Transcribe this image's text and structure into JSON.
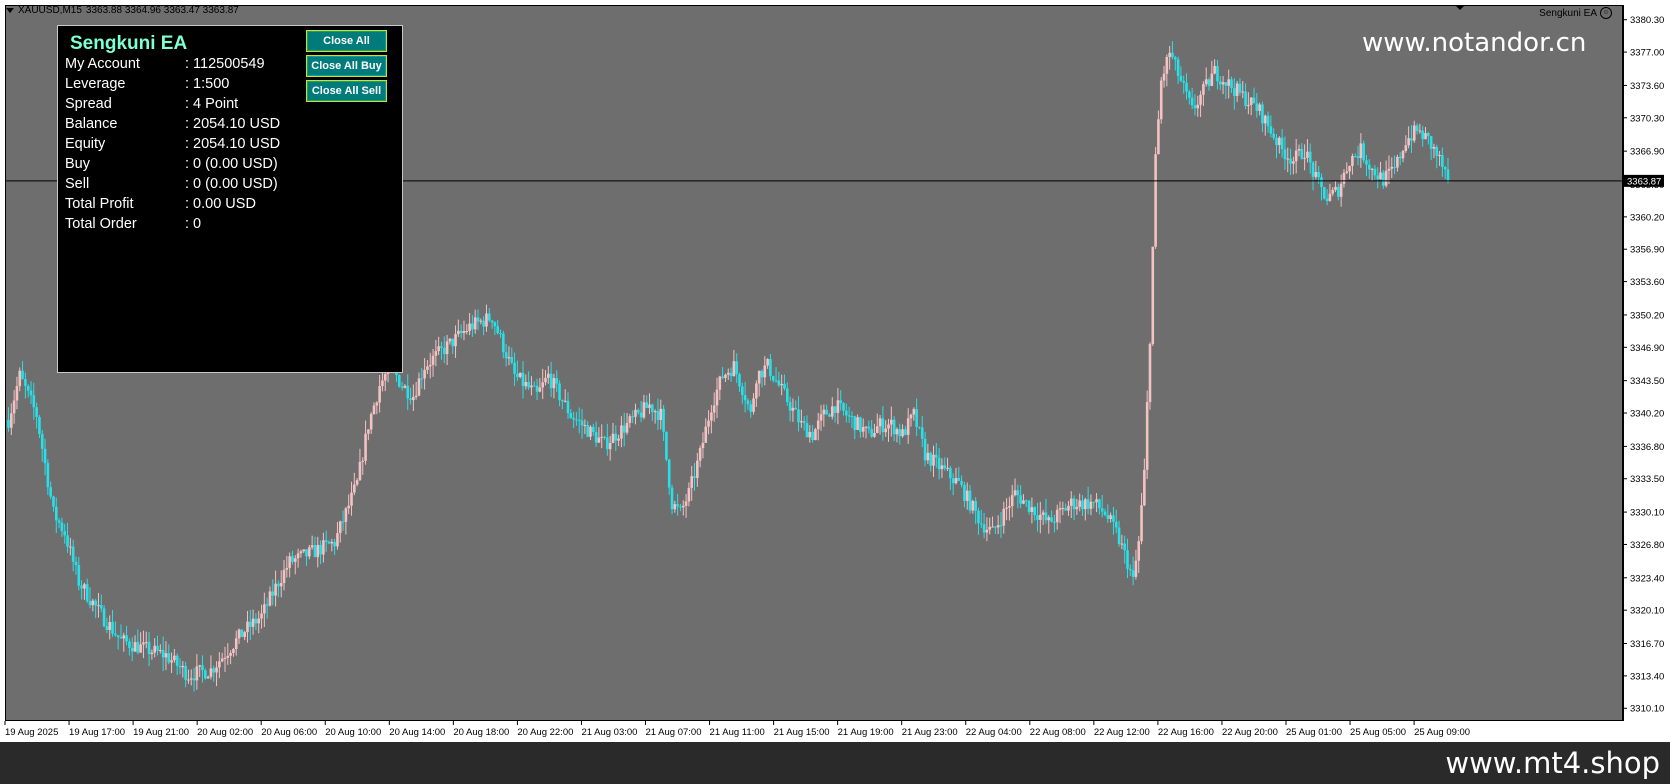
{
  "chart_header": {
    "symbol": "XAUUSD,M15",
    "ohlc": "3363.88 3364.96 3363.47 3363.87",
    "ea_name": "Sengkuni EA"
  },
  "watermark_top": "www.notandor.cn",
  "footer_text": "www.mt4.shop",
  "colors": {
    "chart_bg": "#6e6e6e",
    "bull": "#f4c2c2",
    "bear": "#28e0e8",
    "panel_title": "#7fffd4",
    "button_bg": "#007b7b",
    "footer_bg": "#2a2a2a"
  },
  "panel": {
    "title": "Sengkuni EA",
    "rows": [
      {
        "label": "My Account",
        "value": ": 112500549"
      },
      {
        "label": "Leverage",
        "value": ": 1:500"
      },
      {
        "label": "Spread",
        "value": ": 4 Point"
      },
      {
        "label": "Balance",
        "value": ": 2054.10 USD"
      },
      {
        "label": "Equity",
        "value": ": 2054.10 USD"
      },
      {
        "label": "Buy",
        "value": ": 0 (0.00 USD)"
      },
      {
        "label": "Sell",
        "value": ": 0 (0.00 USD)"
      },
      {
        "label": "Total Profit",
        "value": ": 0.00 USD"
      },
      {
        "label": "Total Order",
        "value": ": 0"
      }
    ],
    "buttons": {
      "close_all": "Close All",
      "close_all_buy": "Close All Buy",
      "close_all_sell": "Close All Sell"
    }
  },
  "chart_data": {
    "type": "candlestick",
    "symbol": "XAUUSD",
    "timeframe": "M15",
    "current_price": "3363.87",
    "ylim": [
      3308.8,
      3381.8
    ],
    "y_ticks": [
      "3380.30",
      "3377.00",
      "3373.60",
      "3370.30",
      "3366.90",
      "3363.50",
      "3360.20",
      "3356.90",
      "3353.60",
      "3350.20",
      "3346.90",
      "3343.50",
      "3340.20",
      "3336.80",
      "3333.50",
      "3330.10",
      "3326.80",
      "3323.40",
      "3320.10",
      "3316.70",
      "3313.40",
      "3310.10"
    ],
    "x_ticks": [
      "19 Aug 2025",
      "19 Aug 17:00",
      "19 Aug 21:00",
      "20 Aug 02:00",
      "20 Aug 06:00",
      "20 Aug 10:00",
      "20 Aug 14:00",
      "20 Aug 18:00",
      "20 Aug 22:00",
      "21 Aug 03:00",
      "21 Aug 07:00",
      "21 Aug 11:00",
      "21 Aug 15:00",
      "21 Aug 19:00",
      "21 Aug 23:00",
      "22 Aug 04:00",
      "22 Aug 08:00",
      "22 Aug 12:00",
      "22 Aug 16:00",
      "22 Aug 20:00",
      "25 Aug 01:00",
      "25 Aug 05:00",
      "25 Aug 09:00"
    ],
    "anchors": [
      [
        0,
        3339.5
      ],
      [
        4,
        3344
      ],
      [
        10,
        3340
      ],
      [
        16,
        3330
      ],
      [
        20,
        3328
      ],
      [
        25,
        3323
      ],
      [
        32,
        3320
      ],
      [
        40,
        3317
      ],
      [
        48,
        3316.2
      ],
      [
        56,
        3315.5
      ],
      [
        64,
        3313.5
      ],
      [
        72,
        3314
      ],
      [
        78,
        3316
      ],
      [
        84,
        3318
      ],
      [
        90,
        3319.5
      ],
      [
        96,
        3323
      ],
      [
        100,
        3325
      ],
      [
        108,
        3326
      ],
      [
        116,
        3327
      ],
      [
        124,
        3333
      ],
      [
        128,
        3339
      ],
      [
        132,
        3343
      ],
      [
        136,
        3345
      ],
      [
        140,
        3343
      ],
      [
        144,
        3342
      ],
      [
        148,
        3345
      ],
      [
        152,
        3346
      ],
      [
        156,
        3347
      ],
      [
        160,
        3348
      ],
      [
        164,
        3349
      ],
      [
        168,
        3349.5
      ],
      [
        172,
        3350
      ],
      [
        176,
        3347
      ],
      [
        180,
        3344
      ],
      [
        184,
        3343
      ],
      [
        188,
        3342
      ],
      [
        192,
        3344
      ],
      [
        196,
        3342
      ],
      [
        200,
        3340
      ],
      [
        204,
        3339
      ],
      [
        208,
        3338
      ],
      [
        212,
        3337
      ],
      [
        216,
        3338
      ],
      [
        220,
        3339
      ],
      [
        224,
        3340
      ],
      [
        228,
        3341
      ],
      [
        232,
        3340
      ],
      [
        236,
        3331
      ],
      [
        239,
        3330
      ],
      [
        242,
        3332
      ],
      [
        246,
        3336
      ],
      [
        250,
        3341
      ],
      [
        254,
        3344
      ],
      [
        258,
        3345
      ],
      [
        262,
        3342
      ],
      [
        264,
        3340
      ],
      [
        266,
        3344
      ],
      [
        270,
        3345
      ],
      [
        274,
        3343
      ],
      [
        278,
        3341
      ],
      [
        282,
        3339
      ],
      [
        286,
        3338
      ],
      [
        290,
        3340
      ],
      [
        294,
        3341
      ],
      [
        298,
        3340
      ],
      [
        302,
        3339
      ],
      [
        306,
        3338
      ],
      [
        310,
        3339
      ],
      [
        314,
        3339
      ],
      [
        318,
        3338
      ],
      [
        322,
        3340
      ],
      [
        326,
        3336
      ],
      [
        330,
        3335
      ],
      [
        334,
        3334
      ],
      [
        338,
        3333
      ],
      [
        342,
        3331
      ],
      [
        346,
        3329
      ],
      [
        350,
        3328
      ],
      [
        354,
        3330
      ],
      [
        358,
        3332
      ],
      [
        362,
        3331
      ],
      [
        366,
        3330
      ],
      [
        370,
        3329
      ],
      [
        374,
        3330
      ],
      [
        378,
        3331
      ],
      [
        382,
        3331
      ],
      [
        386,
        3331
      ],
      [
        390,
        3330
      ],
      [
        394,
        3328
      ],
      [
        398,
        3325
      ],
      [
        400,
        3323
      ],
      [
        402,
        3327
      ],
      [
        404,
        3334
      ],
      [
        406,
        3348
      ],
      [
        408,
        3366
      ],
      [
        410,
        3374
      ],
      [
        413,
        3377
      ],
      [
        417,
        3374
      ],
      [
        421,
        3371
      ],
      [
        425,
        3373
      ],
      [
        429,
        3375
      ],
      [
        433,
        3374
      ],
      [
        437,
        3373
      ],
      [
        441,
        3372
      ],
      [
        445,
        3371
      ],
      [
        449,
        3369
      ],
      [
        453,
        3367
      ],
      [
        457,
        3366
      ],
      [
        461,
        3367
      ],
      [
        465,
        3364
      ],
      [
        469,
        3362
      ],
      [
        473,
        3363
      ],
      [
        477,
        3366
      ],
      [
        481,
        3367
      ],
      [
        485,
        3365
      ],
      [
        489,
        3364
      ],
      [
        493,
        3365
      ],
      [
        497,
        3368
      ],
      [
        501,
        3369
      ],
      [
        505,
        3368
      ],
      [
        509,
        3366
      ],
      [
        512,
        3363.87
      ]
    ],
    "candle_count": 513,
    "candle_seed": 7
  }
}
